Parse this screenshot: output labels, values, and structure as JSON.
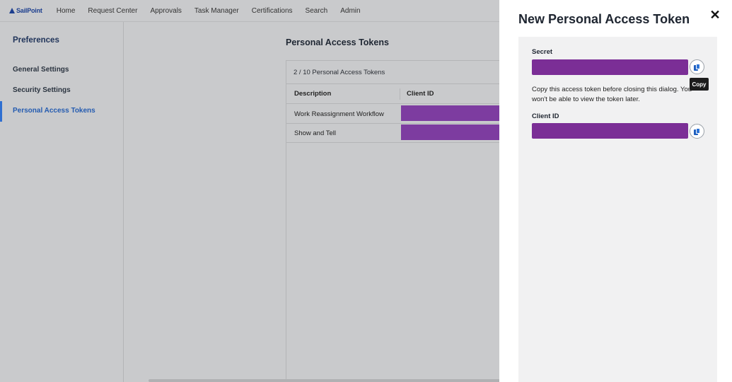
{
  "logo": {
    "text": "SailPoint"
  },
  "nav": {
    "items": [
      "Home",
      "Request Center",
      "Approvals",
      "Task Manager",
      "Certifications",
      "Search",
      "Admin"
    ]
  },
  "sidebar": {
    "title": "Preferences",
    "items": [
      {
        "label": "General Settings"
      },
      {
        "label": "Security Settings"
      },
      {
        "label": "Personal Access Tokens"
      }
    ]
  },
  "main": {
    "title": "Personal Access Tokens",
    "count": "2 / 10 Personal Access Tokens",
    "columns": [
      "Description",
      "Client ID"
    ],
    "rows": [
      {
        "description": "Work Reassignment Workflow"
      },
      {
        "description": "Show and Tell"
      }
    ]
  },
  "drawer": {
    "title": "New Personal Access Token",
    "close_icon": "close-icon",
    "secret_label": "Secret",
    "note": "Copy this access token before closing this dialog. You won't be able to view the token later.",
    "client_id_label": "Client ID",
    "tooltip": "Copy"
  },
  "colors": {
    "redaction": "#7b2e96",
    "accent": "#2f6fd1"
  }
}
